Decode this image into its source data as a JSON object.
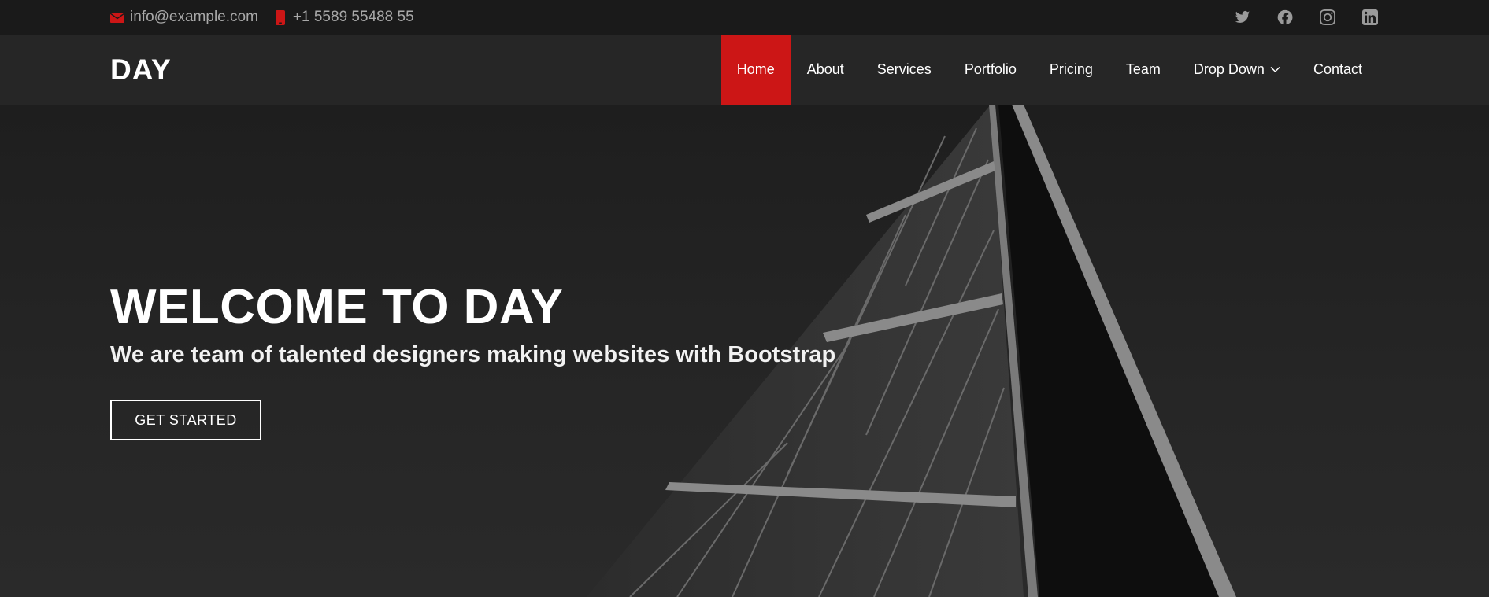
{
  "topbar": {
    "email": "info@example.com",
    "phone": "+1 5589 55488 55",
    "socials": [
      "twitter-icon",
      "facebook-icon",
      "instagram-icon",
      "linkedin-icon"
    ]
  },
  "header": {
    "logo": "DAY",
    "nav": [
      {
        "label": "Home",
        "active": true
      },
      {
        "label": "About"
      },
      {
        "label": "Services"
      },
      {
        "label": "Portfolio"
      },
      {
        "label": "Pricing"
      },
      {
        "label": "Team"
      },
      {
        "label": "Drop Down",
        "dropdown": true
      },
      {
        "label": "Contact"
      }
    ]
  },
  "hero": {
    "title": "WELCOME TO DAY",
    "subtitle": "We are team of talented designers making websites with Bootstrap",
    "cta": "GET STARTED"
  },
  "colors": {
    "accent": "#cc1616",
    "topbar_bg": "#1a1a1a",
    "header_bg": "#262626",
    "hero_bg": "#222222"
  }
}
